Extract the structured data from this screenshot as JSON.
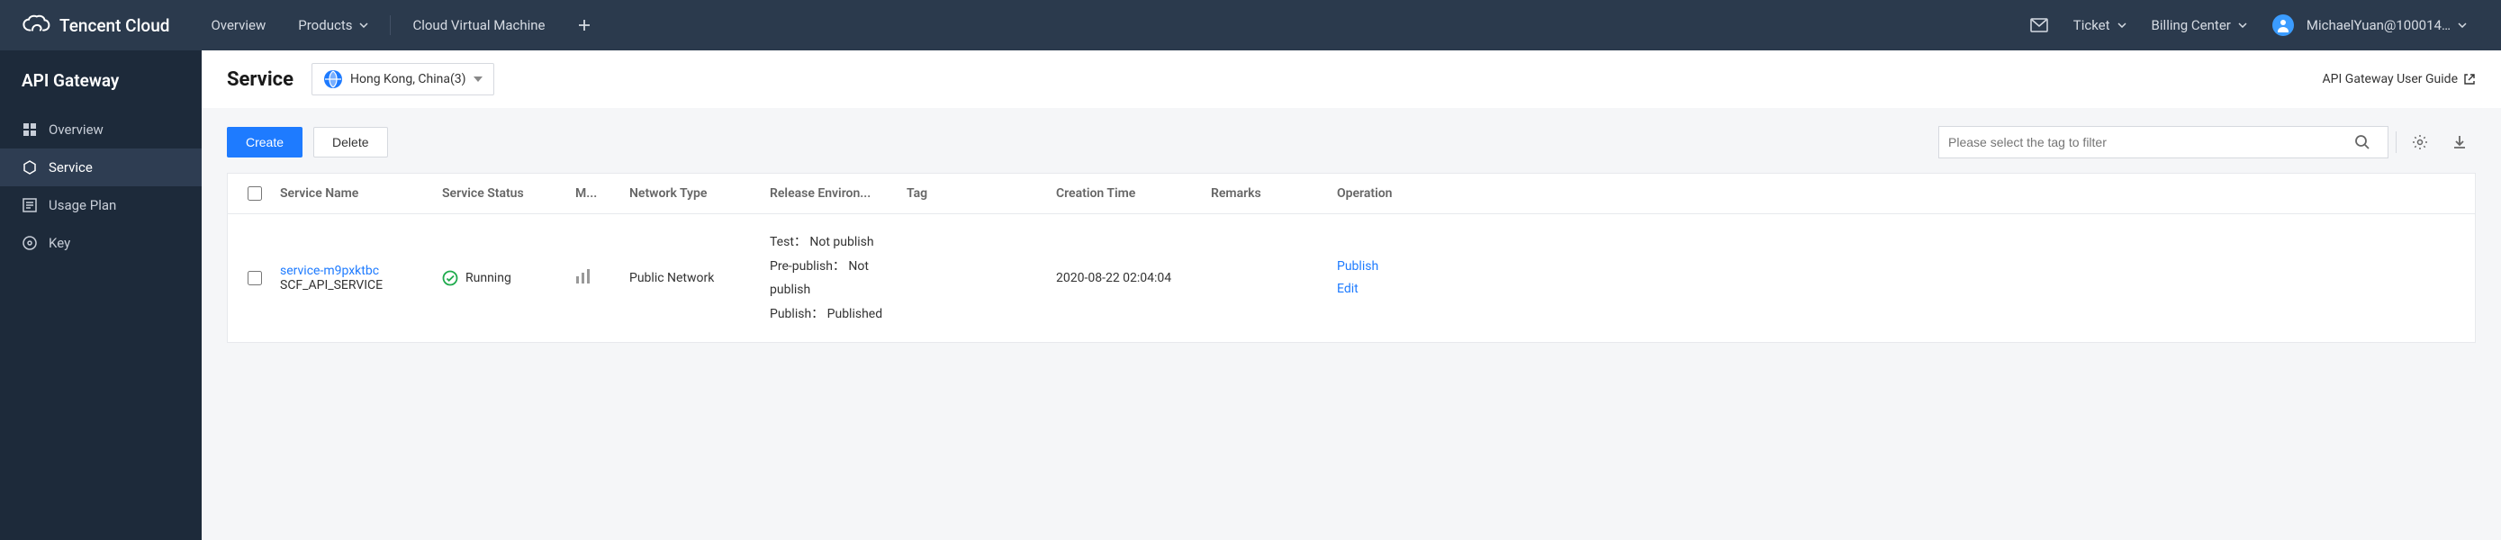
{
  "brand": "Tencent Cloud",
  "topnav": {
    "overview": "Overview",
    "products": "Products",
    "cvm": "Cloud Virtual Machine",
    "ticket": "Ticket",
    "billing": "Billing Center",
    "user": "MichaelYuan@10001­4…"
  },
  "sidebar": {
    "title": "API Gateway",
    "items": [
      {
        "label": "Overview"
      },
      {
        "label": "Service"
      },
      {
        "label": "Usage Plan"
      },
      {
        "label": "Key"
      }
    ]
  },
  "page": {
    "title": "Service",
    "region": "Hong Kong, China(3)",
    "guide": "API Gateway User Guide"
  },
  "toolbar": {
    "create": "Create",
    "delete": "Delete",
    "tag_placeholder": "Please select the tag to filter"
  },
  "table": {
    "headers": {
      "name": "Service Name",
      "status": "Service Status",
      "m": "M...",
      "net": "Network Type",
      "env": "Release Environ...",
      "tag": "Tag",
      "time": "Creation Time",
      "remarks": "Remarks",
      "op": "Operation"
    },
    "rows": [
      {
        "service_id": "service-m9pxktbc",
        "service_name": "SCF_API_SERVICE",
        "status": "Running",
        "network_type": "Public Network",
        "env_test_label": "Test：",
        "env_test_value": "Not publish",
        "env_pre_label": "Pre-publish：",
        "env_pre_value": "Not publish",
        "env_pub_label": "Publish：",
        "env_pub_value": "Published",
        "tag": "",
        "creation_time": "2020-08-22 02:04:04",
        "remarks": "",
        "op_publish": "Publish",
        "op_edit": "Edit"
      }
    ]
  }
}
